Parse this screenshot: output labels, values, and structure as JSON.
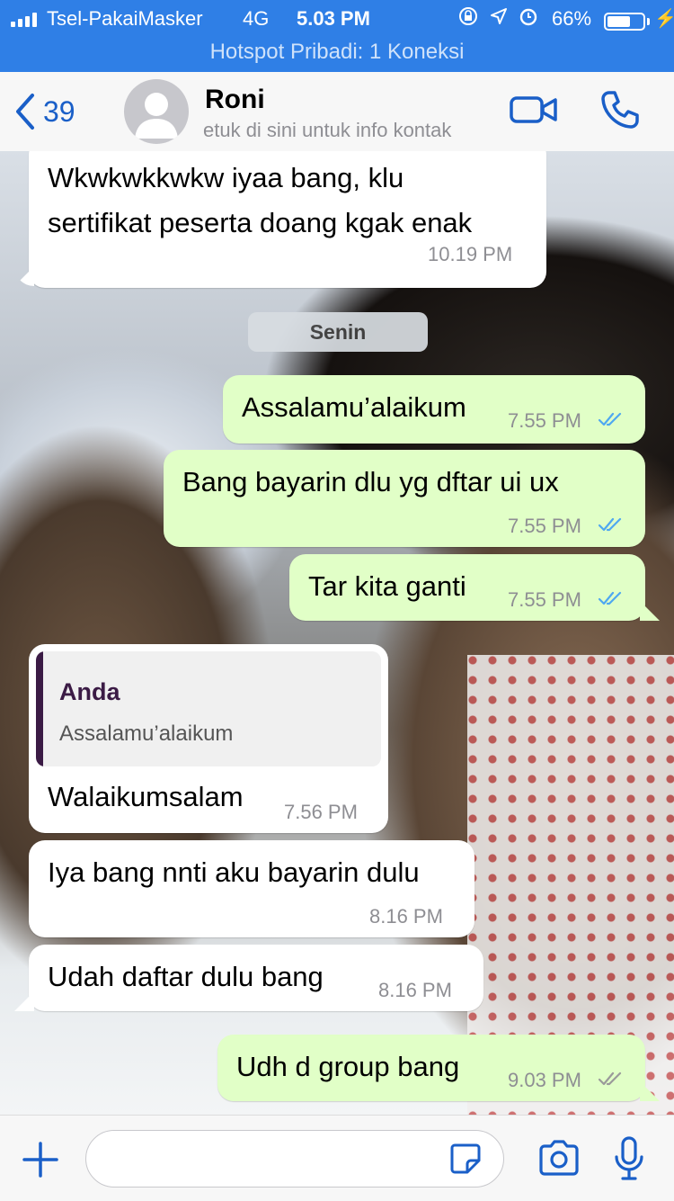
{
  "status_bar": {
    "carrier": "Tsel-PakaiMasker",
    "network": "4G",
    "time": "5.03 PM",
    "battery_pct": "66%",
    "battery_level": 0.66,
    "hotspot": "Hotspot Pribadi: 1 Koneksi"
  },
  "header": {
    "back_count": "39",
    "contact_name": "Roni",
    "contact_subtitle": "etuk di sini untuk info kontak"
  },
  "day_separator": "Senin",
  "messages": [
    {
      "dir": "in",
      "lines": [
        "Wkwkwkkwkw iyaa bang, klu",
        "sertifikat peserta doang kgak enak"
      ],
      "time": "10.19 PM"
    },
    {
      "dir": "out",
      "text": "Assalamu’alaikum",
      "time": "7.55 PM",
      "status": "read"
    },
    {
      "dir": "out",
      "text": "Bang bayarin dlu yg dftar ui ux",
      "time": "7.55 PM",
      "status": "read"
    },
    {
      "dir": "out",
      "text": "Tar kita ganti",
      "time": "7.55 PM",
      "status": "read"
    },
    {
      "dir": "in",
      "reply_to": {
        "author": "Anda",
        "text": "Assalamu’alaikum"
      },
      "text": "Walaikumsalam",
      "time": "7.56 PM"
    },
    {
      "dir": "in",
      "text": "Iya bang nnti aku bayarin dulu",
      "time": "8.16 PM"
    },
    {
      "dir": "in",
      "text": "Udah daftar dulu bang",
      "time": "8.16 PM"
    },
    {
      "dir": "out",
      "text": "Udh d group bang",
      "time": "9.03 PM",
      "status": "delivered"
    }
  ],
  "input": {
    "placeholder": ""
  },
  "colors": {
    "accent": "#1a5fc8",
    "status_bar": "#2f7fe6",
    "outgoing_bubble": "#e1ffc7",
    "incoming_bubble": "#ffffff",
    "read_ticks": "#4fa8f0",
    "delivered_ticks": "#9a9a9a",
    "quote_author": "#3b1b45"
  },
  "icons": {
    "back": "chevron-left-icon",
    "video": "video-camera-icon",
    "call": "phone-icon",
    "plus": "plus-icon",
    "sticker": "sticker-icon",
    "camera": "camera-icon",
    "mic": "microphone-icon"
  }
}
